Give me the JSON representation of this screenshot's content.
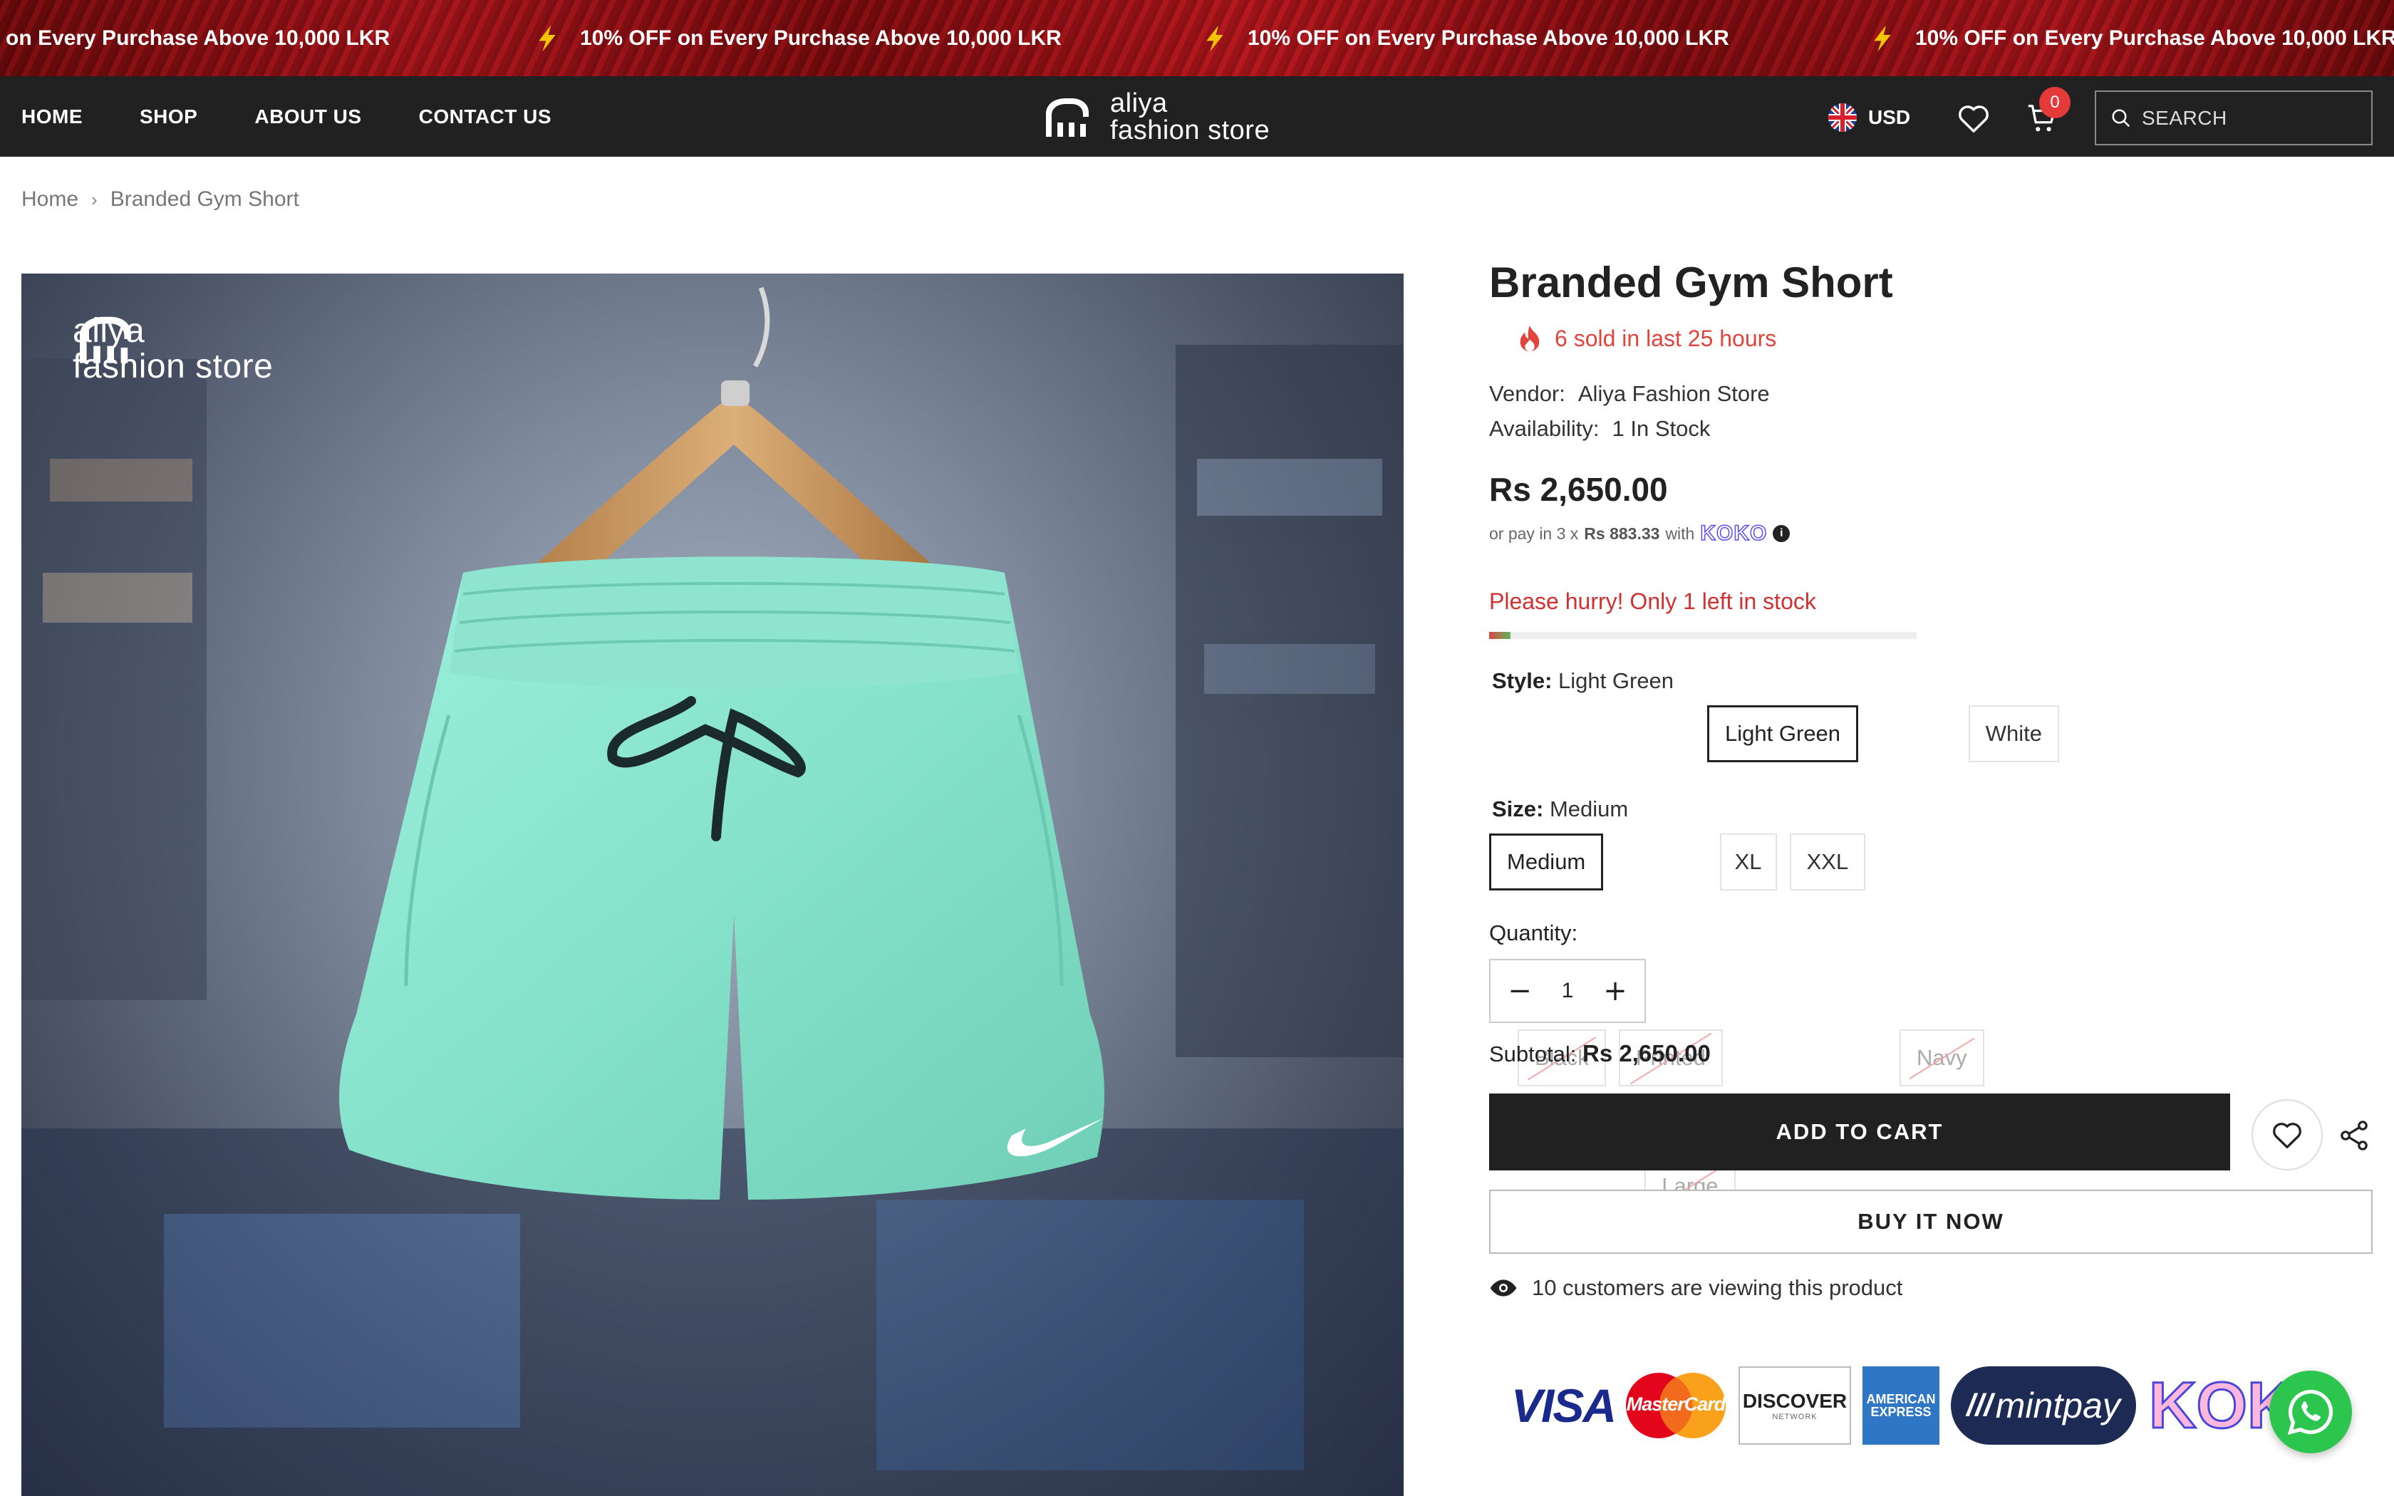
{
  "announcement": {
    "items": [
      "on Every Purchase Above 10,000 LKR",
      "10% OFF on Every Purchase Above 10,000 LKR",
      "10% OFF on Every Purchase Above 10,000 LKR",
      "10% OFF on Every Purchase Above 10,000 LKR"
    ],
    "icon": "lightning-bolt-icon",
    "bolt_color": "#f5c400",
    "background_color": "#9b1218"
  },
  "header": {
    "nav": [
      "HOME",
      "SHOP",
      "ABOUT US",
      "CONTACT US"
    ],
    "logo": {
      "line1": "aliya",
      "line2": "fashion store"
    },
    "currency": "USD",
    "cart_count": "0",
    "search_placeholder": "SEARCH",
    "background_color": "#212121",
    "badge_color": "#e63a3a"
  },
  "breadcrumb": {
    "home": "Home",
    "separator": "›",
    "current": "Branded Gym Short"
  },
  "image": {
    "logo_line1": "aliya",
    "logo_line2": "fashion store"
  },
  "product": {
    "title": "Branded Gym Short",
    "sold_text": "6 sold in last 25 hours",
    "vendor_label": "Vendor:",
    "vendor": "Aliya Fashion Store",
    "availability_label": "Availability:",
    "availability": "1 In Stock",
    "price": "Rs 2,650.00",
    "installment_prefix": "or pay in 3 x",
    "installment_amount": "Rs 883.33",
    "installment_with": "with",
    "installment_brand": "KOKO",
    "hurry_text": "Please hurry! Only 1 left in stock",
    "stock_level": 0.05,
    "style_label": "Style:",
    "style_selected": "Light Green",
    "styles": [
      {
        "label": "Black",
        "state": "sold"
      },
      {
        "label": "Printed",
        "state": "sold"
      },
      {
        "label": "Light Green",
        "state": "active"
      },
      {
        "label": "Navy",
        "state": "sold"
      },
      {
        "label": "White",
        "state": "available"
      }
    ],
    "size_label": "Size:",
    "size_selected": "Medium",
    "sizes": [
      {
        "label": "Medium",
        "state": "active"
      },
      {
        "label": "Large",
        "state": "sold"
      },
      {
        "label": "XL",
        "state": "available"
      },
      {
        "label": "XXL",
        "state": "available"
      }
    ],
    "quantity_label": "Quantity:",
    "quantity": "1",
    "subtotal_label": "Subtotal:",
    "subtotal": "Rs 2,650.00",
    "add_to_cart": "ADD TO CART",
    "buy_now": "BUY IT NOW",
    "viewing_text": "10 customers are viewing this product",
    "accent_color": "#e0443a",
    "short_color": "#8ee6d0"
  },
  "payments": {
    "visa": "VISA",
    "mastercard": "MasterCard",
    "discover": "DISCOVER",
    "discover_sub": "NETWORK",
    "amex_line1": "AMERICAN",
    "amex_line2": "EXPRESS",
    "mintpay": "mintpay",
    "koko": "KOKO"
  }
}
